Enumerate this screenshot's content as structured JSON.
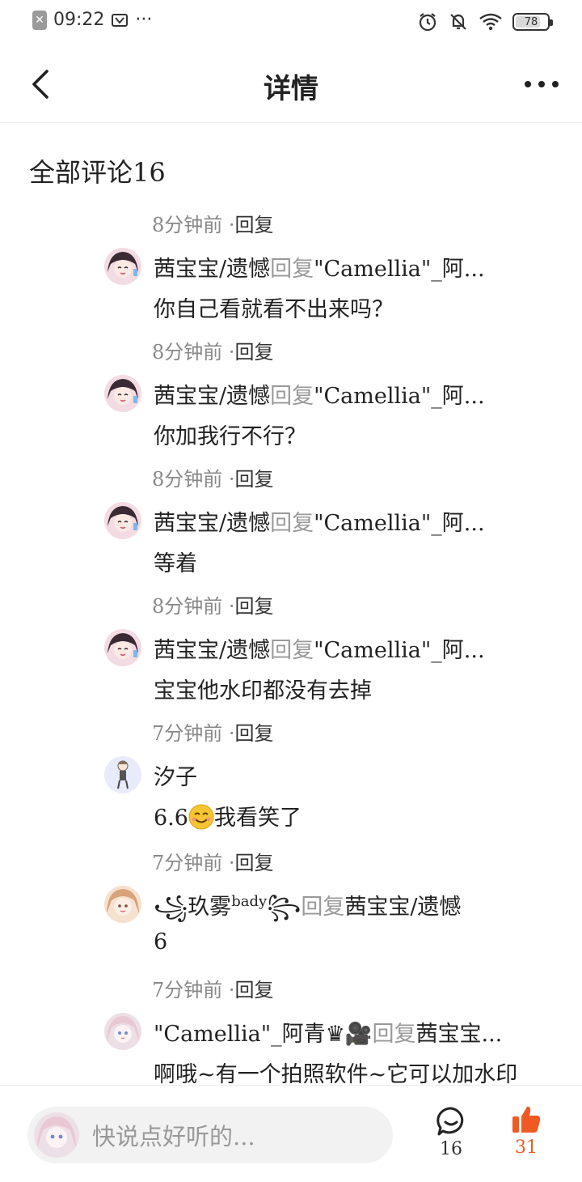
{
  "status_bar": {
    "time": "09:22",
    "battery": "78",
    "battery_level_percent": 78,
    "more_dots": "···",
    "icons": [
      "close-box-icon",
      "screenshot-icon",
      "alarm-icon",
      "mute-icon",
      "wifi-icon",
      "battery-icon"
    ]
  },
  "header": {
    "title": "详情",
    "back_icon": "chevron-left-icon",
    "more_icon": "more-dots-icon"
  },
  "section": {
    "title": "全部评论16"
  },
  "comments": [
    {
      "meta_time": "8分钟前",
      "meta_sep": " ·",
      "reply_label": "回复",
      "author": "茜宝宝/遗憾",
      "reply_word": "回复",
      "target": "\"Camellia\"_阿...",
      "text": "你自己看就看不出来吗？",
      "avatar": "anime-girl-pink"
    },
    {
      "meta_time": "8分钟前",
      "meta_sep": " ·",
      "reply_label": "回复",
      "author": "茜宝宝/遗憾",
      "reply_word": "回复",
      "target": "\"Camellia\"_阿...",
      "text": "你加我行不行？",
      "avatar": "anime-girl-pink"
    },
    {
      "meta_time": "8分钟前",
      "meta_sep": " ·",
      "reply_label": "回复",
      "author": "茜宝宝/遗憾",
      "reply_word": "回复",
      "target": "\"Camellia\"_阿...",
      "text": "等着",
      "avatar": "anime-girl-pink"
    },
    {
      "meta_time": "8分钟前",
      "meta_sep": " ·",
      "reply_label": "回复",
      "author": "茜宝宝/遗憾",
      "reply_word": "回复",
      "target": "\"Camellia\"_阿...",
      "text": "宝宝他水印都没有去掉",
      "avatar": "anime-girl-pink"
    },
    {
      "meta_time": "7分钟前",
      "meta_sep": " ·",
      "reply_label": "回复",
      "author": "汐子",
      "text_prefix": "6.6",
      "text_suffix": "我看笑了",
      "emoji": "smiling-face-emoji",
      "avatar": "chibi-figure-blue"
    },
    {
      "meta_time": "7分钟前",
      "meta_sep": " ·",
      "reply_label": "回复",
      "author_prefix": "꧁",
      "author": "玖雾",
      "author_sup": "bady",
      "author_suffix": "꧂",
      "reply_word": "回复",
      "target": "茜宝宝/遗憾",
      "text": "6",
      "avatar": "anime-girl-orange"
    },
    {
      "meta_time": "7分钟前",
      "meta_sep": " ·",
      "reply_label": "回复",
      "author": "\"Camellia\"_阿青♛🎥",
      "reply_word": "回复",
      "target": "茜宝宝...",
      "text": "啊哦~有一个拍照软件~它可以加水印",
      "avatar": "anime-girl-pale"
    }
  ],
  "bottom_bar": {
    "input_placeholder": "快说点好听的...",
    "comment_count": "16",
    "like_count": "31",
    "comment_icon": "chat-bubble-icon",
    "like_icon": "thumbs-up-icon",
    "like_color": "#f05a22"
  }
}
